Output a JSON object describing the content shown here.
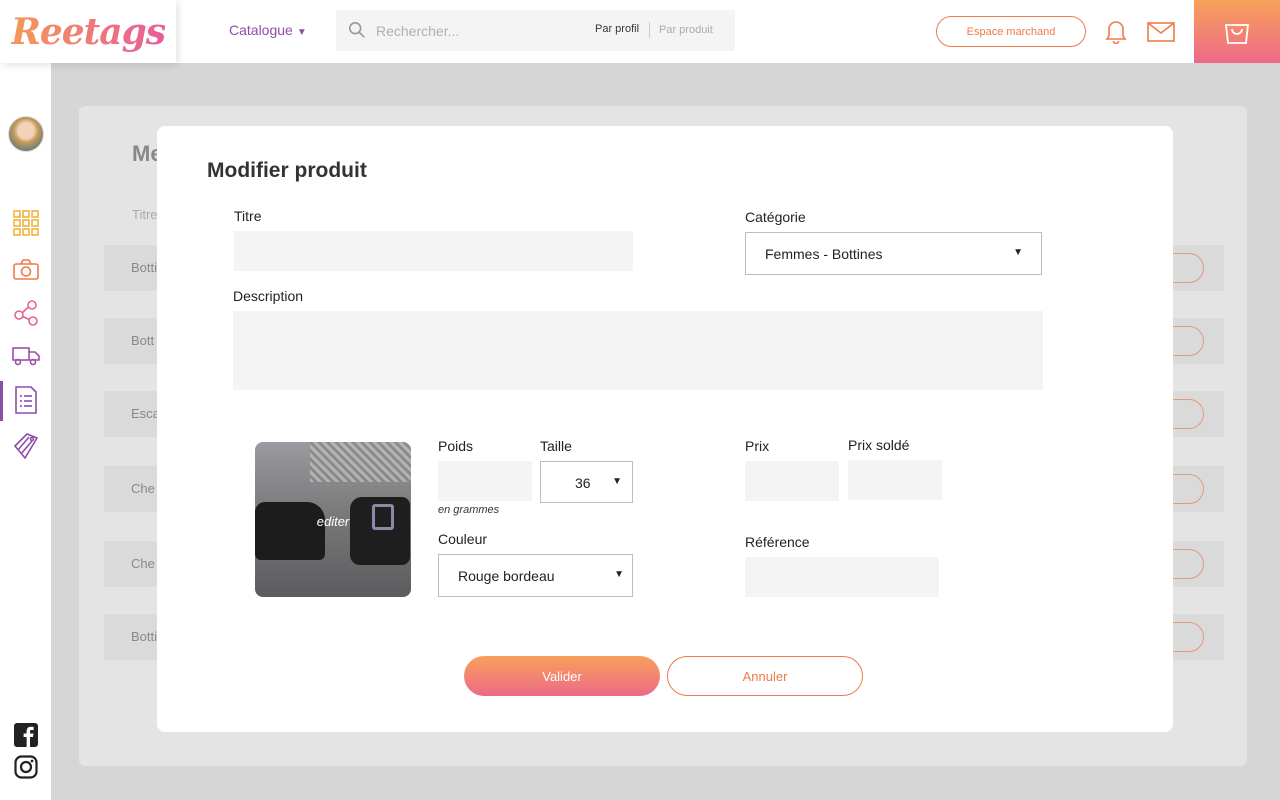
{
  "header": {
    "logo": "Reetags",
    "catalogue_label": "Catalogue",
    "search_placeholder": "Rechercher...",
    "search_mode_profile": "Par profil",
    "search_mode_product": "Par produit",
    "merchant_button": "Espace marchand"
  },
  "sidebar": {
    "icons": [
      "grid-icon",
      "camera-icon",
      "share-icon",
      "truck-icon",
      "list-icon",
      "tags-icon"
    ],
    "social": [
      "facebook-icon",
      "instagram-icon"
    ]
  },
  "background_page": {
    "title_fragment": "Me",
    "column_fragment": "Titre",
    "rows": [
      "Botti",
      "Bott",
      "Esca",
      "Che",
      "Che",
      "Botti"
    ]
  },
  "modal": {
    "title": "Modifier produit",
    "fields": {
      "title_label": "Titre",
      "title_value": "",
      "category_label": "Catégorie",
      "category_value": "Femmes - Bottines",
      "description_label": "Description",
      "description_value": "",
      "weight_label": "Poids",
      "weight_value": "",
      "weight_hint": "en grammes",
      "size_label": "Taille",
      "size_value": "36",
      "color_label": "Couleur",
      "color_value": "Rouge bordeau",
      "price_label": "Prix",
      "price_value": "",
      "sale_price_label": "Prix soldé",
      "sale_price_value": "",
      "reference_label": "Référence",
      "reference_value": ""
    },
    "image_edit_label": "editer",
    "submit_button": "Valider",
    "cancel_button": "Annuler"
  },
  "colors": {
    "accent_orange": "#ef7a4a",
    "accent_pink": "#ec6a88",
    "accent_purple": "#8e4ea8"
  }
}
